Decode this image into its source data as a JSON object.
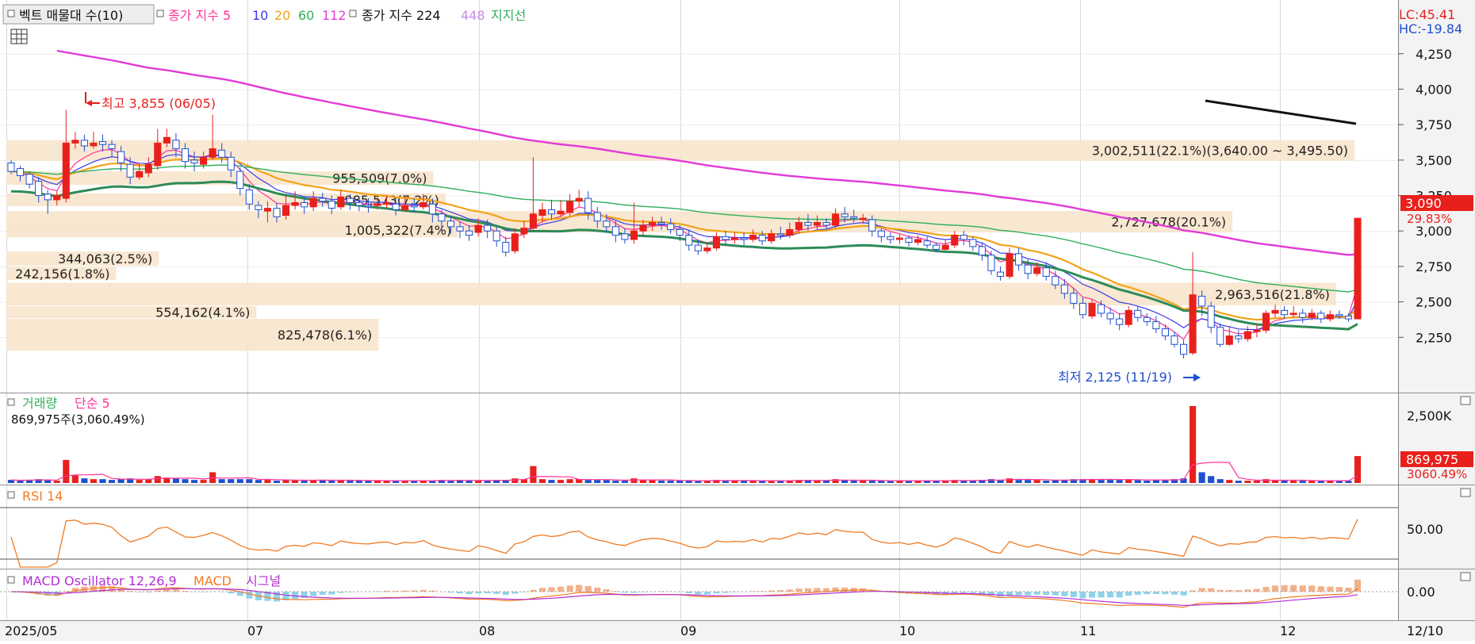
{
  "colors": {
    "up": "#e8201c",
    "down": "#1f4fd1",
    "ma5": "#ff3399",
    "ma10": "#3a3ae8",
    "ma20": "#f2a317",
    "ma60": "#2eaf5a",
    "ma112": "#e23ad6",
    "ma224": "#2e8b57",
    "ma448": "#c78be8",
    "profile": "#f7e4cc",
    "grid": "#d9d9d9",
    "panelBg": "#ffffff",
    "axisBg": "#f3f3f3",
    "priceBox": "#e8201c",
    "lcText": "#e8201c",
    "hcText": "#1f4fd1"
  },
  "legend_top": {
    "item0": "벡트 매물대 수(10)",
    "item1": "종가 지수 5",
    "item2": "10",
    "item3": "20",
    "item4": "60",
    "item5": "112",
    "item6": "종가 지수 224",
    "item7": "448",
    "item8": "지지선"
  },
  "lc": "LC:45.41",
  "hc": "HC:-19.84",
  "current_price_label": "3,090",
  "current_change_label": "29.83%",
  "high_annotation": "최고 3,855 (06/05)",
  "low_annotation": "최저 2,125 (11/19)",
  "volume_panel": {
    "title": "거래량",
    "ma_label": "단순 5",
    "value_line": "869,975주(3,060.49%)",
    "box_value": "869,975",
    "box_change": "3060.49%",
    "tick": "2,500K"
  },
  "rsi_panel": {
    "title": "RSI 14",
    "tick": "50.00"
  },
  "macd_panel": {
    "title": "MACD Oscillator 12,26,9",
    "macd_label": "MACD",
    "signal_label": "시그널",
    "tick": "0.00"
  },
  "x_labels": [
    "2025/05",
    "07",
    "08",
    "09",
    "10",
    "11",
    "12",
    "12/10"
  ],
  "chart_data": {
    "type": "candlestick",
    "ylim": [
      2000,
      4450
    ],
    "y_ticks": [
      4250,
      4000,
      3750,
      3500,
      3250,
      3000,
      2750,
      2500,
      2250
    ],
    "y_tick_labels": [
      "4,250",
      "4,000",
      "3,750",
      "3,500",
      "3,250",
      "3,000",
      "2,750",
      "2,500",
      "2,250"
    ],
    "high": {
      "value": 3855,
      "date": "06/05"
    },
    "low": {
      "value": 2125,
      "date": "11/19"
    },
    "last_close": 3090,
    "volume_profile": [
      {
        "label": "3,002,511(22.1%)(3,640.00 ~ 3,495.50)",
        "lo": 3495.5,
        "hi": 3640,
        "pct": 22.1
      },
      {
        "label": "2,727,678(20.1%)",
        "lo": 2990,
        "hi": 3140,
        "pct": 20.1
      },
      {
        "label": "955,509(7.0%)",
        "lo": 3325,
        "hi": 3420,
        "pct": 7.0
      },
      {
        "label": "985,573(7.2%)",
        "lo": 3175,
        "hi": 3265,
        "pct": 7.2
      },
      {
        "label": "1,005,322(7.4%)",
        "lo": 2955,
        "hi": 3060,
        "pct": 7.4
      },
      {
        "label": "344,063(2.5%)",
        "lo": 2755,
        "hi": 2855,
        "pct": 2.5
      },
      {
        "label": "242,156(1.8%)",
        "lo": 2655,
        "hi": 2745,
        "pct": 1.8
      },
      {
        "label": "2,963,516(21.8%)",
        "lo": 2475,
        "hi": 2635,
        "pct": 21.8
      },
      {
        "label": "554,162(4.1%)",
        "lo": 2385,
        "hi": 2470,
        "pct": 4.1
      },
      {
        "label": "825,478(6.1%)",
        "lo": 2155,
        "hi": 2380,
        "pct": 6.1
      }
    ],
    "candles": [
      [
        3480,
        3420,
        3500,
        3400,
        0.04
      ],
      [
        3440,
        3390,
        3460,
        3350,
        0.03
      ],
      [
        3400,
        3330,
        3420,
        3300,
        0.04
      ],
      [
        3350,
        3250,
        3380,
        3200,
        0.05
      ],
      [
        3260,
        3220,
        3290,
        3120,
        0.04
      ],
      [
        3220,
        3250,
        3280,
        3180,
        0.03
      ],
      [
        3230,
        3620,
        3855,
        3200,
        0.3
      ],
      [
        3620,
        3640,
        3700,
        3580,
        0.1
      ],
      [
        3640,
        3600,
        3680,
        3560,
        0.06
      ],
      [
        3600,
        3620,
        3700,
        3580,
        0.05
      ],
      [
        3630,
        3610,
        3680,
        3560,
        0.05
      ],
      [
        3610,
        3580,
        3640,
        3520,
        0.04
      ],
      [
        3560,
        3480,
        3600,
        3420,
        0.05
      ],
      [
        3470,
        3380,
        3520,
        3330,
        0.06
      ],
      [
        3380,
        3420,
        3480,
        3360,
        0.04
      ],
      [
        3410,
        3470,
        3520,
        3380,
        0.05
      ],
      [
        3460,
        3620,
        3720,
        3430,
        0.09
      ],
      [
        3620,
        3660,
        3720,
        3590,
        0.07
      ],
      [
        3640,
        3580,
        3690,
        3520,
        0.06
      ],
      [
        3580,
        3490,
        3620,
        3440,
        0.05
      ],
      [
        3500,
        3480,
        3560,
        3420,
        0.04
      ],
      [
        3470,
        3520,
        3560,
        3440,
        0.04
      ],
      [
        3520,
        3580,
        3820,
        3500,
        0.14
      ],
      [
        3570,
        3520,
        3620,
        3480,
        0.05
      ],
      [
        3520,
        3430,
        3560,
        3380,
        0.05
      ],
      [
        3420,
        3300,
        3450,
        3250,
        0.05
      ],
      [
        3290,
        3190,
        3330,
        3150,
        0.05
      ],
      [
        3180,
        3150,
        3210,
        3090,
        0.04
      ],
      [
        3140,
        3160,
        3210,
        3060,
        0.04
      ],
      [
        3160,
        3100,
        3200,
        3060,
        0.03
      ],
      [
        3110,
        3180,
        3250,
        3080,
        0.04
      ],
      [
        3180,
        3200,
        3280,
        3150,
        0.04
      ],
      [
        3200,
        3170,
        3240,
        3120,
        0.03
      ],
      [
        3170,
        3230,
        3280,
        3140,
        0.04
      ],
      [
        3230,
        3210,
        3270,
        3170,
        0.04
      ],
      [
        3210,
        3160,
        3250,
        3120,
        0.03
      ],
      [
        3170,
        3240,
        3290,
        3150,
        0.04
      ],
      [
        3230,
        3200,
        3260,
        3150,
        0.03
      ],
      [
        3200,
        3180,
        3240,
        3140,
        0.03
      ],
      [
        3180,
        3170,
        3230,
        3130,
        0.03
      ],
      [
        3180,
        3190,
        3240,
        3150,
        0.03
      ],
      [
        3190,
        3200,
        3250,
        3160,
        0.03
      ],
      [
        3190,
        3150,
        3230,
        3110,
        0.03
      ],
      [
        3150,
        3180,
        3240,
        3140,
        0.03
      ],
      [
        3180,
        3170,
        3230,
        3130,
        0.03
      ],
      [
        3170,
        3200,
        3260,
        3150,
        0.03
      ],
      [
        3190,
        3120,
        3230,
        3060,
        0.03
      ],
      [
        3120,
        3070,
        3150,
        3000,
        0.04
      ],
      [
        3070,
        3030,
        3110,
        2980,
        0.03
      ],
      [
        3030,
        3000,
        3070,
        2950,
        0.04
      ],
      [
        3000,
        2970,
        3040,
        2930,
        0.03
      ],
      [
        2990,
        3040,
        3090,
        2960,
        0.03
      ],
      [
        3040,
        3000,
        3080,
        2950,
        0.03
      ],
      [
        3000,
        2930,
        3030,
        2890,
        0.04
      ],
      [
        2920,
        2850,
        2960,
        2820,
        0.04
      ],
      [
        2860,
        2980,
        3020,
        2840,
        0.06
      ],
      [
        2980,
        3020,
        3070,
        2950,
        0.05
      ],
      [
        3020,
        3120,
        3520,
        3000,
        0.22
      ],
      [
        3110,
        3150,
        3200,
        3060,
        0.05
      ],
      [
        3150,
        3120,
        3220,
        3080,
        0.04
      ],
      [
        3120,
        3140,
        3220,
        3100,
        0.04
      ],
      [
        3130,
        3210,
        3260,
        3100,
        0.05
      ],
      [
        3210,
        3230,
        3290,
        3170,
        0.05
      ],
      [
        3230,
        3130,
        3280,
        3080,
        0.04
      ],
      [
        3130,
        3070,
        3170,
        3020,
        0.04
      ],
      [
        3070,
        3030,
        3120,
        2990,
        0.04
      ],
      [
        3030,
        2970,
        3070,
        2920,
        0.03
      ],
      [
        2980,
        2940,
        3020,
        2910,
        0.03
      ],
      [
        2940,
        3000,
        3200,
        2910,
        0.06
      ],
      [
        3000,
        3040,
        3080,
        2960,
        0.04
      ],
      [
        3040,
        3060,
        3100,
        3000,
        0.04
      ],
      [
        3060,
        3050,
        3100,
        3010,
        0.03
      ],
      [
        3050,
        3010,
        3090,
        2980,
        0.03
      ],
      [
        3010,
        2970,
        3040,
        2930,
        0.03
      ],
      [
        2970,
        2900,
        3010,
        2860,
        0.03
      ],
      [
        2900,
        2860,
        2940,
        2830,
        0.03
      ],
      [
        2860,
        2880,
        2920,
        2840,
        0.03
      ],
      [
        2880,
        2960,
        2990,
        2860,
        0.04
      ],
      [
        2960,
        2940,
        3000,
        2900,
        0.03
      ],
      [
        2940,
        2950,
        2990,
        2910,
        0.03
      ],
      [
        2950,
        2940,
        2990,
        2900,
        0.03
      ],
      [
        2940,
        2970,
        3010,
        2920,
        0.03
      ],
      [
        2970,
        2930,
        3000,
        2900,
        0.03
      ],
      [
        2930,
        2980,
        3010,
        2910,
        0.03
      ],
      [
        2980,
        2970,
        3030,
        2940,
        0.03
      ],
      [
        2970,
        3010,
        3060,
        2950,
        0.03
      ],
      [
        3010,
        3060,
        3100,
        2980,
        0.04
      ],
      [
        3060,
        3040,
        3120,
        3000,
        0.04
      ],
      [
        3040,
        3060,
        3110,
        3010,
        0.03
      ],
      [
        3060,
        3040,
        3090,
        3010,
        0.03
      ],
      [
        3040,
        3120,
        3160,
        3020,
        0.05
      ],
      [
        3120,
        3100,
        3170,
        3060,
        0.04
      ],
      [
        3100,
        3090,
        3150,
        3060,
        0.03
      ],
      [
        3080,
        3090,
        3120,
        3050,
        0.03
      ],
      [
        3080,
        3000,
        3110,
        2960,
        0.03
      ],
      [
        3000,
        2960,
        3020,
        2920,
        0.03
      ],
      [
        2960,
        2940,
        2990,
        2910,
        0.03
      ],
      [
        2940,
        2950,
        2980,
        2910,
        0.03
      ],
      [
        2950,
        2920,
        2970,
        2890,
        0.03
      ],
      [
        2920,
        2940,
        2970,
        2900,
        0.03
      ],
      [
        2930,
        2900,
        2960,
        2880,
        0.03
      ],
      [
        2900,
        2870,
        2920,
        2850,
        0.03
      ],
      [
        2870,
        2900,
        2940,
        2860,
        0.03
      ],
      [
        2900,
        2970,
        3000,
        2880,
        0.04
      ],
      [
        2970,
        2940,
        3000,
        2900,
        0.03
      ],
      [
        2940,
        2890,
        2960,
        2860,
        0.03
      ],
      [
        2890,
        2830,
        2920,
        2790,
        0.04
      ],
      [
        2830,
        2720,
        2860,
        2690,
        0.05
      ],
      [
        2710,
        2680,
        2750,
        2650,
        0.04
      ],
      [
        2680,
        2840,
        2880,
        2660,
        0.06
      ],
      [
        2840,
        2760,
        2880,
        2720,
        0.04
      ],
      [
        2760,
        2700,
        2800,
        2660,
        0.04
      ],
      [
        2700,
        2740,
        2780,
        2680,
        0.04
      ],
      [
        2740,
        2680,
        2780,
        2650,
        0.03
      ],
      [
        2680,
        2620,
        2720,
        2590,
        0.04
      ],
      [
        2620,
        2560,
        2660,
        2520,
        0.04
      ],
      [
        2560,
        2490,
        2600,
        2450,
        0.05
      ],
      [
        2490,
        2410,
        2530,
        2380,
        0.05
      ],
      [
        2400,
        2490,
        2520,
        2380,
        0.05
      ],
      [
        2480,
        2420,
        2510,
        2390,
        0.04
      ],
      [
        2420,
        2380,
        2460,
        2340,
        0.04
      ],
      [
        2380,
        2340,
        2420,
        2300,
        0.04
      ],
      [
        2340,
        2440,
        2470,
        2320,
        0.05
      ],
      [
        2440,
        2390,
        2470,
        2360,
        0.04
      ],
      [
        2390,
        2360,
        2420,
        2330,
        0.03
      ],
      [
        2360,
        2310,
        2400,
        2280,
        0.04
      ],
      [
        2310,
        2260,
        2340,
        2230,
        0.04
      ],
      [
        2260,
        2200,
        2290,
        2180,
        0.05
      ],
      [
        2200,
        2130,
        2230,
        2100,
        0.06
      ],
      [
        2140,
        2550,
        2850,
        2125,
        1.0
      ],
      [
        2540,
        2470,
        2580,
        2400,
        0.14
      ],
      [
        2470,
        2320,
        2500,
        2280,
        0.09
      ],
      [
        2320,
        2200,
        2350,
        2180,
        0.05
      ],
      [
        2200,
        2260,
        2330,
        2190,
        0.04
      ],
      [
        2260,
        2240,
        2300,
        2210,
        0.03
      ],
      [
        2240,
        2290,
        2330,
        2220,
        0.03
      ],
      [
        2290,
        2300,
        2340,
        2250,
        0.03
      ],
      [
        2300,
        2420,
        2440,
        2280,
        0.05
      ],
      [
        2420,
        2440,
        2480,
        2390,
        0.04
      ],
      [
        2440,
        2410,
        2470,
        2380,
        0.03
      ],
      [
        2410,
        2420,
        2470,
        2390,
        0.03
      ],
      [
        2420,
        2390,
        2450,
        2350,
        0.03
      ],
      [
        2390,
        2420,
        2450,
        2370,
        0.03
      ],
      [
        2420,
        2380,
        2440,
        2350,
        0.03
      ],
      [
        2380,
        2410,
        2440,
        2360,
        0.03
      ],
      [
        2410,
        2400,
        2440,
        2380,
        0.03
      ],
      [
        2400,
        2380,
        2420,
        2360,
        0.03
      ],
      [
        2380,
        3090,
        3090,
        2380,
        0.35
      ]
    ]
  }
}
